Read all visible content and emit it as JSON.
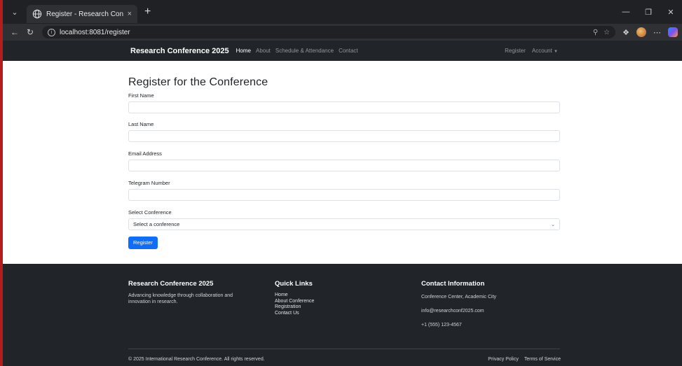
{
  "browser": {
    "tab_title": "Register - Research Conference",
    "tab_close": "×",
    "new_tab": "+",
    "url": "localhost:8081/register",
    "icons": [
      "tab-menu-icon",
      "globe-icon",
      "back-icon",
      "reload-icon",
      "info-icon",
      "zoom-icon",
      "favorite-icon",
      "collections-icon",
      "profile-avatar",
      "more-icon",
      "copilot-icon",
      "minimize-icon",
      "maximize-icon",
      "close-icon"
    ]
  },
  "nav": {
    "brand": "Research Conference 2025",
    "links": [
      "Home",
      "About",
      "Schedule & Attendance",
      "Contact"
    ],
    "register": "Register",
    "account": "Account"
  },
  "form": {
    "title": "Register for the Conference",
    "fields": {
      "first_name": {
        "label": "First Name",
        "value": ""
      },
      "last_name": {
        "label": "Last Name",
        "value": ""
      },
      "email": {
        "label": "Email Address",
        "value": ""
      },
      "telegram": {
        "label": "Telegram Number",
        "value": ""
      },
      "conference": {
        "label": "Select Conference",
        "selected": "Select a conference"
      }
    },
    "submit_label": "Register"
  },
  "footer": {
    "about": {
      "heading": "Research Conference 2025",
      "text": "Advancing knowledge through collaboration and innovation in research."
    },
    "quick_links": {
      "heading": "Quick Links",
      "items": [
        "Home",
        "About Conference",
        "Registration",
        "Contact Us"
      ]
    },
    "contact": {
      "heading": "Contact Information",
      "address": "Conference Center, Academic City",
      "email": "info@researchconf2025.com",
      "phone": "+1 (555) 123-4567"
    },
    "copyright": "© 2025 International Research Conference. All rights reserved.",
    "privacy": "Privacy Policy",
    "terms": "Terms of Service"
  },
  "colors": {
    "primary": "#0d6efd",
    "dark": "#212529"
  }
}
